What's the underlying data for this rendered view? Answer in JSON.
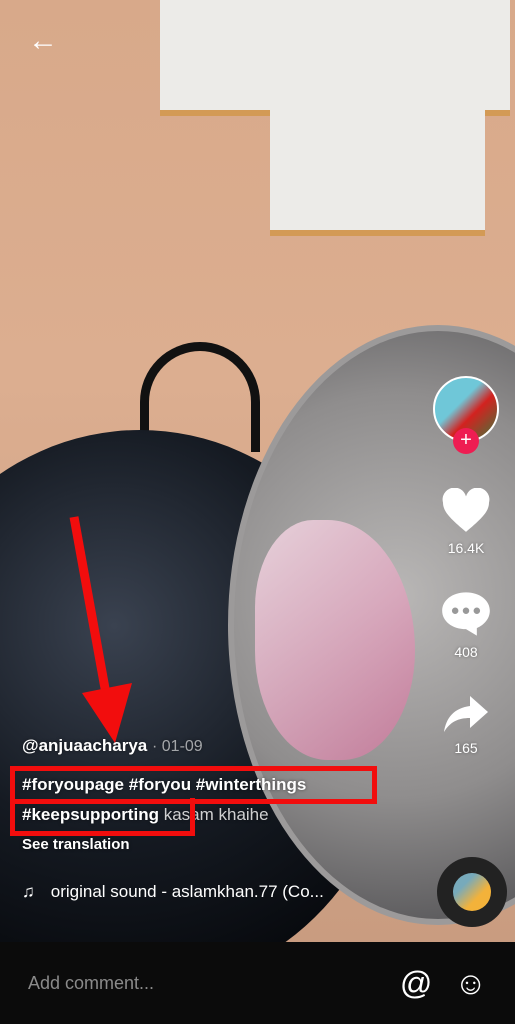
{
  "video": {
    "author": "@anjuaacharya",
    "date": "· 01-09",
    "hashtags_line1": "#foryoupage #foryou #winterthings",
    "hashtag_line2": "#keepsupporting",
    "caption_rest": "kasam khaihe",
    "see_translation": "See translation",
    "sound": "original sound - aslamkhan.77 (Co..."
  },
  "actions": {
    "likes": "16.4K",
    "comments": "408",
    "shares": "165"
  },
  "bottom": {
    "comment_placeholder": "Add comment..."
  },
  "colors": {
    "annotation": "#f20d0d",
    "follow": "#ee1d52"
  }
}
